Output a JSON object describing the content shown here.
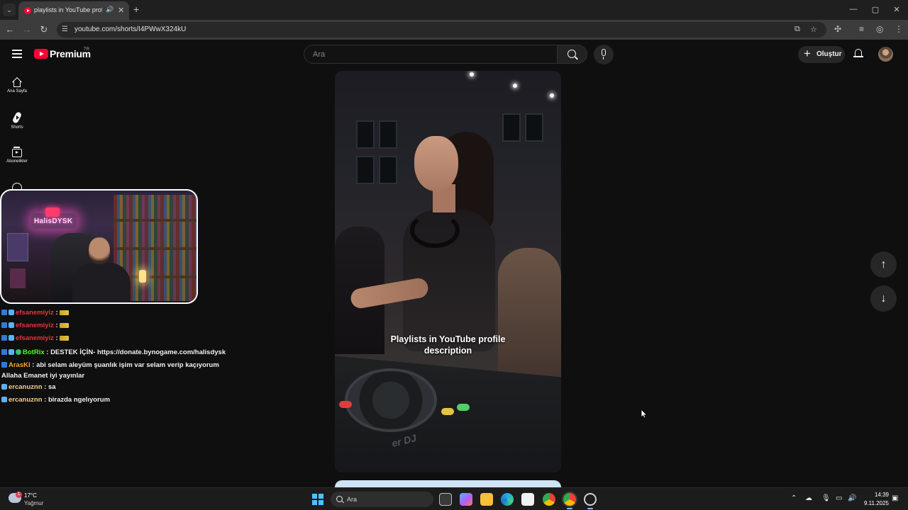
{
  "browser": {
    "tab_title": "playlists in YouTube profile",
    "url": "youtube.com/shorts/I4PWwX324kU",
    "new_tab": "+",
    "controls": {
      "minimize": "—",
      "maximize": "▢",
      "close": "✕"
    }
  },
  "youtube": {
    "logo_text": "Premium",
    "country_code": "TR",
    "search_placeholder": "Ara",
    "create_label": "Oluştur",
    "sidebar": [
      {
        "label": "Ana Sayfa",
        "icon": "home-icon"
      },
      {
        "label": "Shorts",
        "icon": "shorts-icon"
      },
      {
        "label": "Abonelikler",
        "icon": "subscriptions-icon"
      }
    ],
    "short": {
      "caption_line1": "Playlists in YouTube profile",
      "caption_line2": "description"
    }
  },
  "stream_overlay": {
    "neon_sign": "HalisDYSK",
    "chat": [
      {
        "user": "efsanemiyiz",
        "message": ":",
        "color": "#e8323c",
        "badges": [
          "k",
          "c"
        ],
        "emote": true
      },
      {
        "user": "efsanemiyiz",
        "message": ":",
        "color": "#e8323c",
        "badges": [
          "k",
          "c"
        ],
        "emote": true
      },
      {
        "user": "efsanemiyiz",
        "message": ":",
        "color": "#e8323c",
        "badges": [
          "k",
          "c"
        ],
        "emote": true
      },
      {
        "user": "BotRix",
        "message": ": DESTEK İÇİN- https://donate.bynogame.com/halisdysk",
        "color": "#53fc18",
        "badges": [
          "k",
          "c",
          "v"
        ],
        "emote": false
      },
      {
        "user": "ArasKl",
        "message": ": abi selam aleyüm şuanlık işim var selam verip kaçıyorum Allaha Emanet iyi yayınlar",
        "color": "#f5a623",
        "badges": [
          "k"
        ],
        "emote": false
      },
      {
        "user": "ercanuznn",
        "message": ": sa",
        "color": "#f7d08a",
        "badges": [
          "c"
        ],
        "emote": false
      },
      {
        "user": "ercanuznn",
        "message": ": birazda ngelıyorum",
        "color": "#f7d08a",
        "badges": [
          "c"
        ],
        "emote": false
      }
    ]
  },
  "taskbar": {
    "weather_temp": "17°C",
    "weather_desc": "Yağmur",
    "weather_badge": "1",
    "search_label": "Ara",
    "time": "14:39",
    "date": "9.11.2025"
  },
  "colors": {
    "background": "#0f0f0f",
    "youtube_red": "#ff0033",
    "chrome_toolbar": "#3c3c3c"
  }
}
